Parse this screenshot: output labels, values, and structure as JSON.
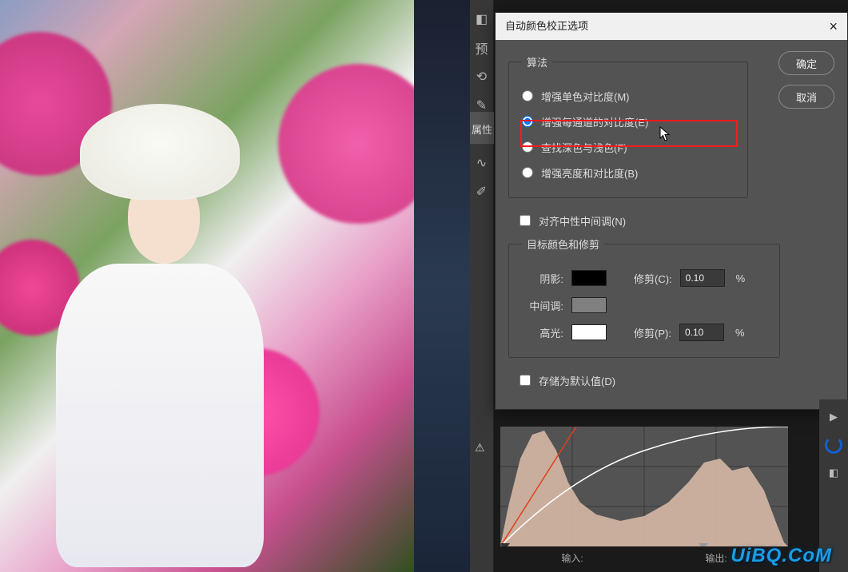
{
  "dialog": {
    "title": "自动颜色校正选项",
    "ok": "确定",
    "cancel": "取消",
    "algorithm": {
      "legend": "算法",
      "opt_mono": "增强单色对比度(M)",
      "opt_per_channel": "增强每通道的对比度(E)",
      "opt_dark_light": "查找深色与浅色(F)",
      "opt_bright_contrast": "增强亮度和对比度(B)",
      "selected": "per_channel"
    },
    "snap_neutral": "对齐中性中间调(N)",
    "targets": {
      "legend": "目标颜色和修剪",
      "shadows_label": "阴影:",
      "shadows_swatch": "#000000",
      "clip_label_c": "修剪(C):",
      "clip_c_value": "0.10",
      "midtones_label": "中间调:",
      "midtones_swatch": "#808080",
      "highlights_label": "高光:",
      "highlights_swatch": "#ffffff",
      "clip_label_p": "修剪(P):",
      "clip_p_value": "0.10",
      "percent": "%"
    },
    "save_default": "存储为默认值(D)"
  },
  "panels": {
    "prop_label": "属性",
    "input_label": "输入:",
    "output_label": "输出:"
  },
  "icons": {
    "histogram": "histogram-icon",
    "play": "play-icon",
    "loading": "loading-icon",
    "swatches": "swatches-icon"
  },
  "watermark": "UiBQ.CoM"
}
